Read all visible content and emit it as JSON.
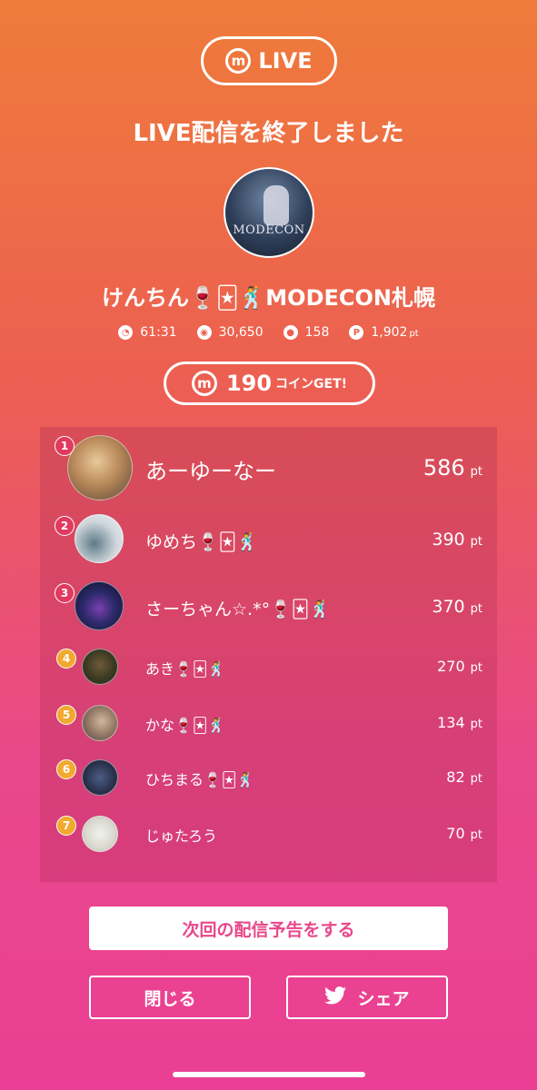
{
  "header": {
    "brand_letter": "m",
    "brand_label": "LIVE",
    "title": "LIVE配信を終了しました"
  },
  "host": {
    "name": "けんちん🍷🃏🕺MODECON札幌",
    "avatar_text": "MODECON"
  },
  "stats": [
    {
      "icon": "timer-icon",
      "value": "61:31"
    },
    {
      "icon": "viewers-icon",
      "value": "30,650"
    },
    {
      "icon": "comment-icon",
      "value": "158"
    },
    {
      "icon": "points-icon",
      "value": "1,902",
      "unit": "pt"
    }
  ],
  "coins": {
    "amount": "190",
    "label": "コインGET!"
  },
  "ranking": [
    {
      "rank": "1",
      "name": "あーゆーなー",
      "points": "586",
      "unit": "pt"
    },
    {
      "rank": "2",
      "name": "ゆめち🍷🃏🕺",
      "points": "390",
      "unit": "pt"
    },
    {
      "rank": "3",
      "name": "さーちゃん☆.*°🍷🃏🕺",
      "points": "370",
      "unit": "pt"
    },
    {
      "rank": "4",
      "name": "あき🍷🃏🕺",
      "points": "270",
      "unit": "pt"
    },
    {
      "rank": "5",
      "name": "かな🍷🃏🕺",
      "points": "134",
      "unit": "pt"
    },
    {
      "rank": "6",
      "name": "ひちまる🍷🃏🕺",
      "points": "82",
      "unit": "pt"
    },
    {
      "rank": "7",
      "name": "じゅたろう",
      "points": "70",
      "unit": "pt"
    }
  ],
  "actions": {
    "schedule": "次回の配信予告をする",
    "close": "閉じる",
    "share": "シェア"
  }
}
